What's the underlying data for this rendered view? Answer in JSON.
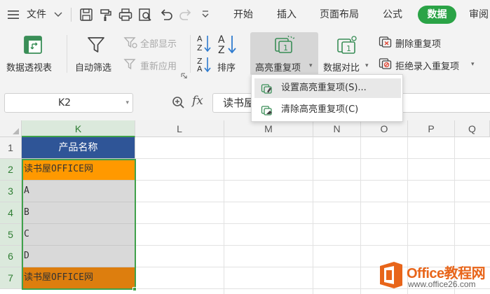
{
  "menubar": {
    "file_label": "文件",
    "tabs": [
      {
        "label": "开始"
      },
      {
        "label": "插入"
      },
      {
        "label": "页面布局"
      },
      {
        "label": "公式"
      },
      {
        "label": "数据"
      },
      {
        "label": "审阅"
      }
    ],
    "active_tab": "数据",
    "active_color": "#2aa346"
  },
  "ribbon": {
    "pivot_label": "数据透视表",
    "autofilter_label": "自动筛选",
    "show_all_label": "全部显示",
    "reapply_label": "重新应用",
    "sort_label": "排序",
    "highlight_dup_label": "高亮重复项",
    "compare_label": "数据对比",
    "remove_dup_label": "删除重复项",
    "reject_dup_label": "拒绝录入重复项"
  },
  "dropdown": {
    "items": [
      {
        "label": "设置高亮重复项(S)..."
      },
      {
        "label": "清除高亮重复项(C)"
      }
    ]
  },
  "formula_bar": {
    "cell_ref": "K2",
    "fx_label": "fx",
    "content": "读书屋"
  },
  "grid": {
    "columns": [
      "K",
      "L",
      "M",
      "N",
      "O",
      "P",
      "Q"
    ],
    "rows": [
      "1",
      "2",
      "3",
      "4",
      "5",
      "6",
      "7"
    ],
    "selected_column": "K",
    "cells": [
      {
        "text": "产品名称",
        "bg": "#2f5597"
      },
      {
        "text": "读书屋OFFICE网",
        "bg": "#ff9900"
      },
      {
        "text": "A",
        "bg": "#d9d9d9"
      },
      {
        "text": "B",
        "bg": "#d9d9d9"
      },
      {
        "text": "C",
        "bg": "#d9d9d9"
      },
      {
        "text": "D",
        "bg": "#d9d9d9"
      },
      {
        "text": "读书屋OFFICE网",
        "bg": "#dd7e0e"
      }
    ]
  },
  "watermark": {
    "title": "Office教程网",
    "url": "www.office26.com",
    "color": "#e8651a"
  }
}
